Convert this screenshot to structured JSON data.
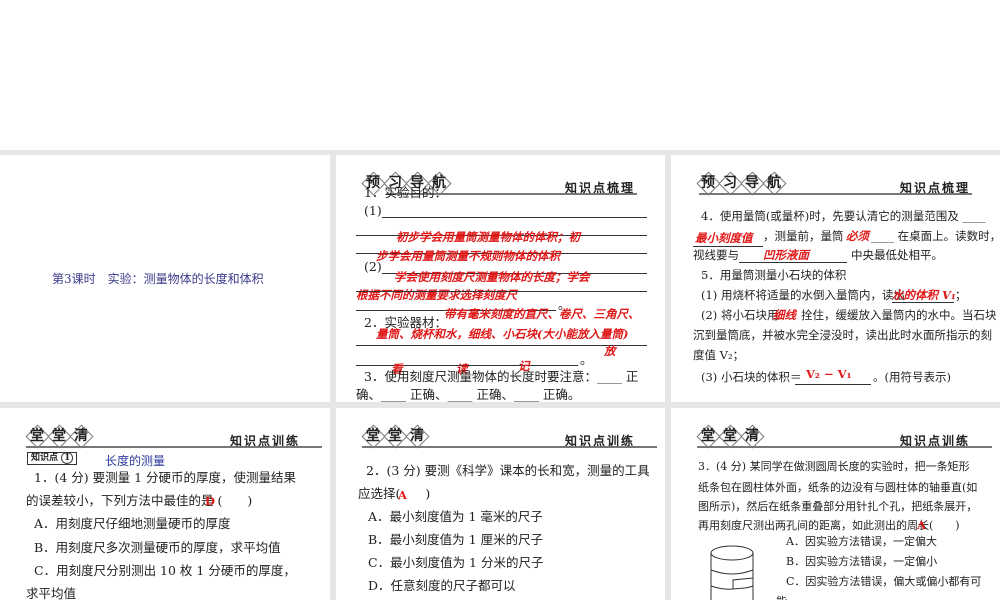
{
  "slide1": {
    "title": "第3课时　实验：测量物体的长度和体积"
  },
  "preview_badge": [
    "预",
    "习",
    "导",
    "航"
  ],
  "class_badge": [
    "堂",
    "堂",
    "清"
  ],
  "preview_right": "知识点梳理",
  "class_right": "知识点训练",
  "slide2": {
    "l1": "1．实验目的：",
    "p1": "(1)",
    "p2": "(2)",
    "a1": "初步学会用量筒测量物体的体积；初",
    "a2": "步学会用量筒测量不规则物体的体积",
    "a3": "学会使用刻度尺测量物体的长度；学会",
    "a4": "根据不同的测量要求选择刻度尺",
    "dot": "。",
    "l2": "2．实验器材：",
    "a5": "带有毫米刻度的直尺、卷尺、三角尺、",
    "a6": "量筒、烧杯和水，细线、小石块(大小能放入量筒)",
    "a7": "放",
    "a8": "看",
    "a9": "读",
    "a10": "记",
    "l3": "3．使用刻度尺测量物体的长度时要注意：____ 正",
    "l4": "确、____ 正确、____ 正确、____ 正确。"
  },
  "slide3": {
    "l1": "4．使用量筒(或量杯)时，先要认清它的测量范围及 ____",
    "a1": "最小刻度值",
    "l2a": "，测量前，量筒",
    "a2": "必须",
    "l2b": "____ 在桌面上。读数时，",
    "l3a": "视线要与",
    "a3": "凹形液面",
    "l3b": "中央最低处相平。",
    "l4": "5．用量筒测量小石块的体积",
    "l5a": "(1) 用烧杯将适量的水倒入量筒内，读出",
    "a4": "水的体积 V₁",
    "l5b": "；",
    "l6a": "(2) 将小石块用",
    "a5": "细线",
    "l6b": "拴住，缓缓放入量筒内的水中。当石块",
    "l7": "沉到量筒底，并被水完全浸没时，读出此时水面所指示的刻",
    "l8": "度值 V₂；",
    "l9a": "(3) 小石块的体积＝",
    "a6": "V₂ − V₁",
    "l9b": "。(用符号表示)"
  },
  "slide4": {
    "kp_label": "知识点",
    "kp_num": "1",
    "kp_title": "长度的测量",
    "q1": "1．(4 分) 要测量 1 分硬币的厚度，使测量结果",
    "q2": "的误差较小，下列方法中最佳的是 (　　)",
    "ans": "D",
    "oA": "A．用刻度尺仔细地测量硬币的厚度",
    "oB": "B．用刻度尺多次测量硬币的厚度，求平均值",
    "oC": "C．用刻度尺分别测出 10 枚 1 分硬币的厚度，",
    "oC2": "求平均值"
  },
  "slide5": {
    "q1": "2．(3 分) 要测《科学》课本的长和宽，测量的工具",
    "q2": "应选择(　　)",
    "ans": "A",
    "oA": "A．最小刻度值为 1 毫米的尺子",
    "oB": "B．最小刻度值为 1 厘米的尺子",
    "oC": "C．最小刻度值为 1 分米的尺子",
    "oD": "D．任意刻度的尺子都可以"
  },
  "slide6": {
    "q1": "3．(4 分) 某同学在做测圆周长度的实验时，把一条矩形",
    "q2": "纸条包在圆柱体外面，纸条的边没有与圆柱体的轴垂直(如",
    "q3": "图所示)，然后在纸条重叠部分用针扎个孔，把纸条展开，",
    "q4": "再用刻度尺测出两孔间的距离，如此测出的周长(　　)",
    "ans": "A",
    "oA": "A．因实验方法错误，一定偏大",
    "oB": "B．因实验方法错误，一定偏小",
    "oC": "C．因实验方法错误，偏大或偏小都有可",
    "oC2": "能"
  },
  "colors": {
    "answer": "#e01818",
    "title": "#3a3a8a",
    "band": "#e6e6e6"
  }
}
